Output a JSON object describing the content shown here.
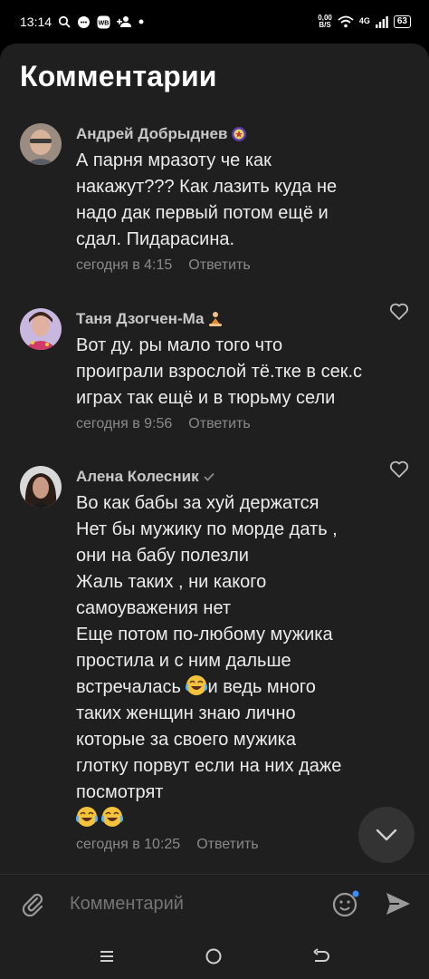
{
  "status_bar": {
    "time": "13:14",
    "speed_value": "0,00",
    "speed_unit": "B/S",
    "network": "4G",
    "battery": "63"
  },
  "sheet": {
    "title": "Комментарии"
  },
  "comments": [
    {
      "author": "Андрей Добрыднев",
      "text": "А парня мразоту че как\nнакажут??? Как лазить куда не\nнадо дак первый потом ещё и\nсдал. Пидарасина.",
      "time": "сегодня в 4:15",
      "reply": "Ответить"
    },
    {
      "author": "Таня Дзогчен-Ма",
      "text": "Вот ду. ры мало того что\nпроиграли взрослой тё.тке в сек.с\nиграх так ещё и в тюрьму сели",
      "time": "сегодня в 9:56",
      "reply": "Ответить"
    },
    {
      "author": "Алена Колесник",
      "text_before_emoji": "Во как бабы за хуй держатся\nНет бы мужику по морде дать ,\nони на бабу полезли\nЖаль таких , ни какого\nсамоуважения нет\nЕще потом по-любому мужика\nпростила и с ним дальше\nвстречалась ",
      "text_after_emoji": "и ведь много\nтаких женщин знаю лично\nкоторые за своего мужика\nглотку порвут если на них даже\nпосмотрят",
      "time": "сегодня в 10:25",
      "reply": "Ответить"
    }
  ],
  "composer": {
    "placeholder": "Комментарий"
  },
  "icons": {
    "badge1": "purple-star-badge-icon",
    "badge2": "meditation-emoji-icon",
    "verified": "verified-check-icon",
    "emoji": "crying-laughing-emoji-icon"
  }
}
